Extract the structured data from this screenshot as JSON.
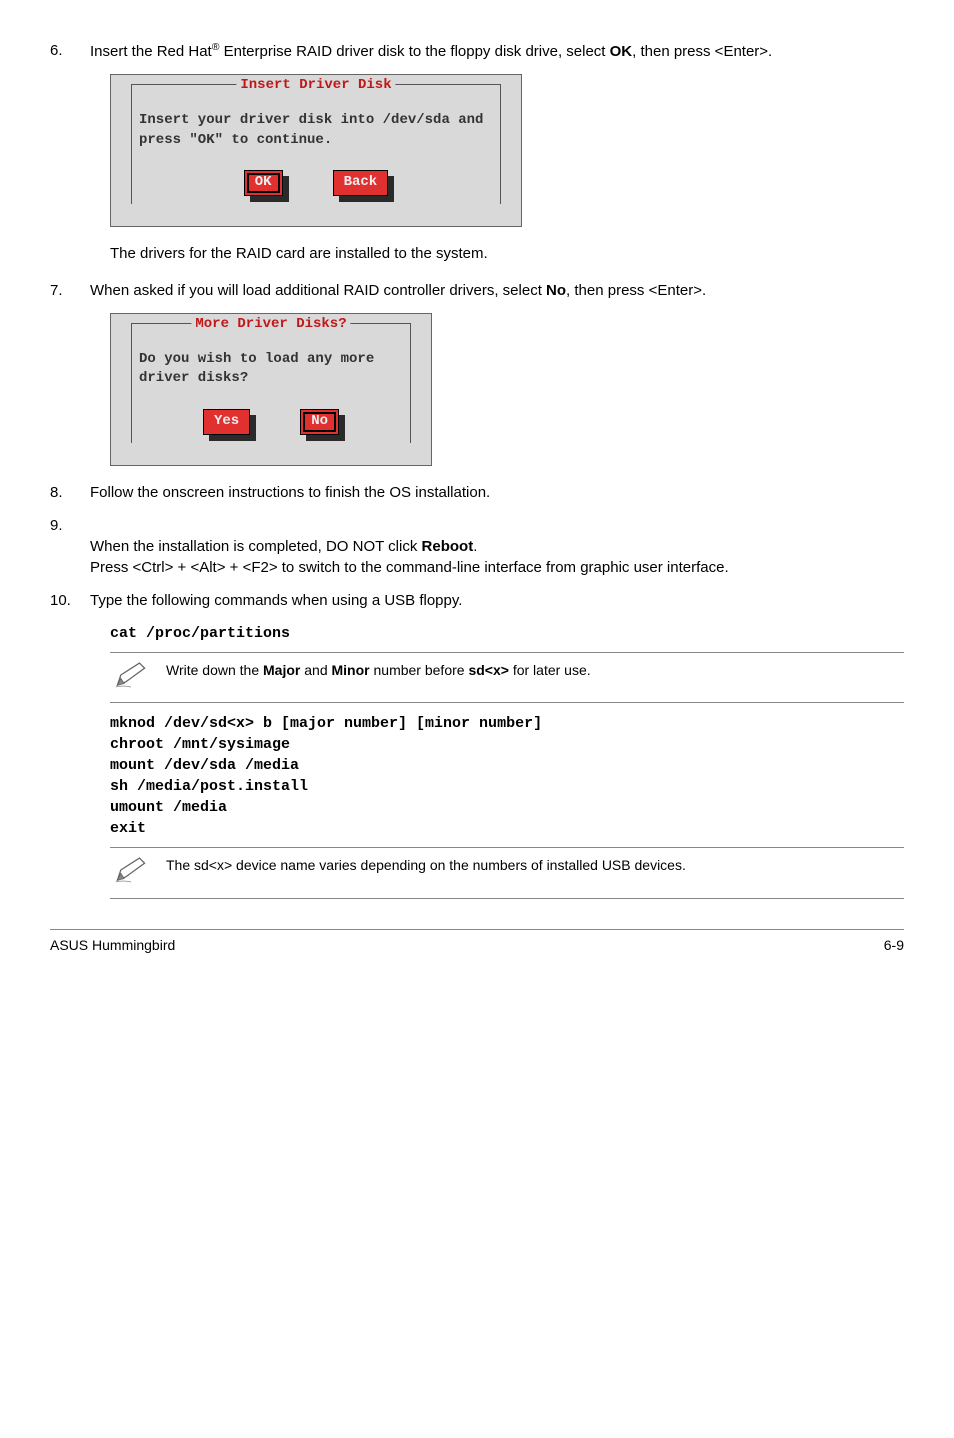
{
  "step6": {
    "num": "6.",
    "text_parts": [
      "Insert the Red Hat",
      "®",
      " Enterprise RAID driver disk to the floppy disk drive, select ",
      "OK",
      ", then press <Enter>."
    ]
  },
  "dialog_insert": {
    "title": "Insert Driver Disk",
    "text": "Insert your driver disk into /dev/sda and press \"OK\" to continue.",
    "ok": "OK",
    "back": "Back"
  },
  "after6_text": "The drivers for the RAID card are installed to the system.",
  "step7": {
    "num": "7.",
    "text_parts": [
      "When asked if you will load additional RAID controller drivers, select ",
      "No",
      ", then press <Enter>."
    ]
  },
  "dialog_more": {
    "title": "More Driver Disks?",
    "text": "Do you wish to load any more driver disks?",
    "yes": "Yes",
    "no": "No"
  },
  "step8": {
    "num": "8.",
    "text": "Follow the onscreen instructions to finish the OS installation."
  },
  "step9": {
    "num": "9.",
    "text_parts": [
      "When the installation is completed, DO NOT click ",
      "Reboot",
      ".\nPress <Ctrl> + <Alt> + <F2> to switch to the command-line interface from graphic user interface."
    ]
  },
  "step10": {
    "num": "10.",
    "text": "Type the following commands when using a USB floppy."
  },
  "code1": "cat /proc/partitions",
  "note1_parts": [
    "Write down the ",
    "Major",
    " and ",
    "Minor",
    " number before ",
    "sd<x>",
    " for later use."
  ],
  "code2": "mknod /dev/sd<x> b [major number] [minor number]\nchroot /mnt/sysimage\nmount /dev/sda /media\nsh /media/post.install\numount /media\nexit",
  "note2": "The sd<x> device name varies depending on the numbers of installed USB devices.",
  "footer_left": "ASUS Hummingbird",
  "footer_right": "6-9"
}
